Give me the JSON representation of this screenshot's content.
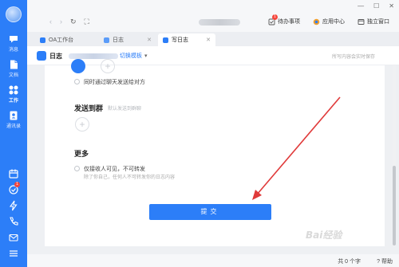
{
  "sidebar": {
    "items": [
      {
        "label": "消息",
        "icon": "chat-icon"
      },
      {
        "label": "文档",
        "icon": "document-icon"
      },
      {
        "label": "工作",
        "icon": "workbench-icon",
        "active": true
      },
      {
        "label": "通讯录",
        "icon": "contacts-icon"
      }
    ],
    "bottom_icons": [
      "calendar-icon",
      "todo-icon",
      "lightning-icon",
      "phone-icon",
      "mail-icon",
      "more-icon"
    ],
    "todo_badge": "1"
  },
  "titlebar": {
    "todo_label": "待办事项",
    "todo_badge": "1",
    "appcenter_label": "应用中心",
    "standalone_label": "独立窗口"
  },
  "tabs": [
    {
      "label": "OA工作台"
    },
    {
      "label": "日志"
    },
    {
      "label": "写日志",
      "active": true
    }
  ],
  "doc_header": {
    "title": "日志",
    "switch_template": "切换模板",
    "autosave": "所写内容会实时保存"
  },
  "content": {
    "option_sync": "同时通过聊天发送给对方",
    "send_group_title": "发送到群",
    "send_group_hint": "默认发送到群聊",
    "more_title": "更多",
    "option_receiver_only": "仅接收人可见，不可转发",
    "option_receiver_only_sub": "除了你自己，任何人不可转发你的日志内容",
    "submit_label": "提交"
  },
  "statusbar": {
    "wordcount": "共 0 个字",
    "help": "帮助"
  },
  "colors": {
    "accent": "#2c7ef8",
    "arrow": "#e03a3a",
    "badge": "#f5463c"
  }
}
